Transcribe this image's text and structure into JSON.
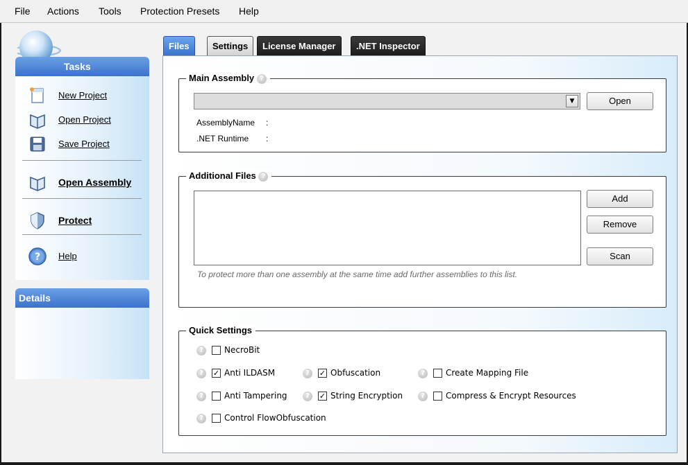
{
  "menu": [
    "File",
    "Actions",
    "Tools",
    "Protection Presets",
    "Help"
  ],
  "tasks_panel": {
    "title": "Tasks",
    "items": [
      {
        "label": "New Project"
      },
      {
        "label": "Open Project"
      },
      {
        "label": "Save Project"
      },
      {
        "label": "Open Assembly"
      },
      {
        "label": "Protect"
      },
      {
        "label": "Help"
      }
    ]
  },
  "details_panel": {
    "title": "Details"
  },
  "tabs": [
    {
      "label": "Files",
      "active": true
    },
    {
      "label": "Settings",
      "active": false
    },
    {
      "label": "License Manager",
      "active": false
    },
    {
      "label": ".NET Inspector",
      "active": false
    }
  ],
  "main_assembly": {
    "title": "Main Assembly",
    "combo_value": "",
    "open_button": "Open",
    "assembly_name_label": "AssemblyName",
    "assembly_name_value": ":",
    "runtime_label": ".NET Runtime",
    "runtime_value": ":"
  },
  "additional_files": {
    "title": "Additional Files",
    "items": [],
    "buttons": {
      "add": "Add",
      "remove": "Remove",
      "scan": "Scan"
    },
    "hint": "To protect more than one assembly at the same time add further assemblies to this list."
  },
  "quick_settings": {
    "title": "Quick Settings",
    "options": [
      {
        "label": "NecroBit",
        "checked": false
      },
      {
        "label": "Anti ILDASM",
        "checked": true
      },
      {
        "label": "Obfuscation",
        "checked": true
      },
      {
        "label": "Create Mapping File",
        "checked": false
      },
      {
        "label": "Anti Tampering",
        "checked": false
      },
      {
        "label": "String Encryption",
        "checked": true
      },
      {
        "label": "Compress & Encrypt Resources",
        "checked": false
      },
      {
        "label": "Control FlowObfuscation",
        "checked": false
      }
    ]
  },
  "colors": {
    "accent": "#3c72cc",
    "panel_header": "#6aa0e4"
  }
}
